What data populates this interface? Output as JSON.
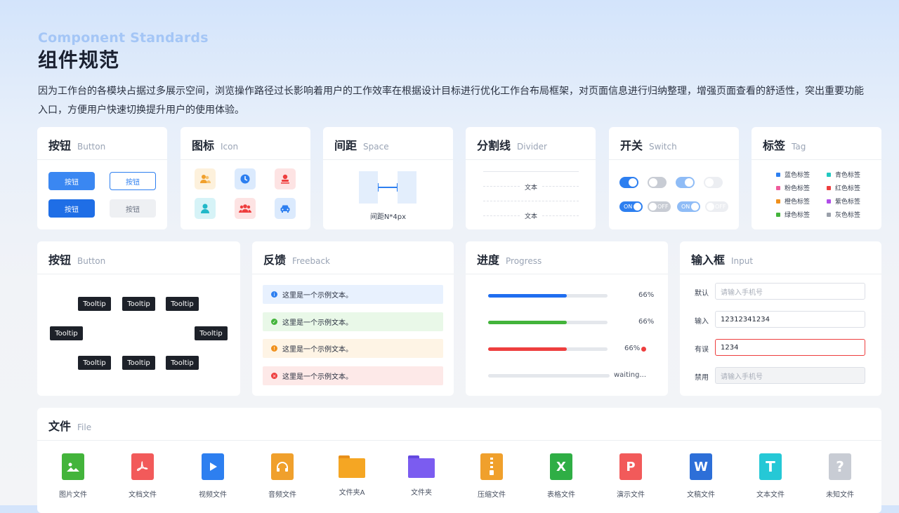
{
  "header": {
    "title_en": "Component Standards",
    "title_cn": "组件规范",
    "description": "因为工作台的各模块占据过多展示空间，浏览操作路径过长影响着用户的工作效率在根据设计目标进行优化工作台布局框架，对页面信息进行归纳整理，增强页面查看的舒适性，突出重要功能入口，方便用户快速切换提升用户的使用体验。"
  },
  "colors": {
    "primary": "#2d7ff0",
    "success": "#43b43b",
    "warning": "#f0901c",
    "error": "#ee3e3e"
  },
  "button_card": {
    "title": "按钮",
    "subtitle": "Button",
    "buttons": [
      "按钮",
      "按钮",
      "按钮",
      "按钮"
    ]
  },
  "icon_card": {
    "title": "图标",
    "subtitle": "Icon",
    "icons": [
      "users-icon",
      "clock-icon",
      "stamp-icon",
      "user-icon",
      "group-icon",
      "car-icon"
    ]
  },
  "space_card": {
    "title": "间距",
    "subtitle": "Space",
    "label": "间距N*4px"
  },
  "divider_card": {
    "title": "分割线",
    "subtitle": "Divider",
    "text1": "文本",
    "text2": "文本"
  },
  "switch_card": {
    "title": "开关",
    "subtitle": "Switch",
    "on": "ON",
    "off": "OFF"
  },
  "tag_card": {
    "title": "标签",
    "subtitle": "Tag",
    "tags": [
      {
        "label": "蓝色标签",
        "color": "#2d7ff0"
      },
      {
        "label": "青色标签",
        "color": "#21c8c0"
      },
      {
        "label": "粉色标签",
        "color": "#ef5b9c"
      },
      {
        "label": "红色标签",
        "color": "#ee3e3e"
      },
      {
        "label": "橙色标签",
        "color": "#f0901c"
      },
      {
        "label": "紫色标签",
        "color": "#b04ce8"
      },
      {
        "label": "绿色标签",
        "color": "#43b43b"
      },
      {
        "label": "灰色标签",
        "color": "#9aa0aa"
      }
    ]
  },
  "tooltip_card": {
    "title": "按钮",
    "subtitle": "Button",
    "tooltip": "Tooltip"
  },
  "feedback_card": {
    "title": "反馈",
    "subtitle": "Freeback",
    "messages": [
      "这里是一个示例文本。",
      "这里是一个示例文本。",
      "这里是一个示例文本。",
      "这里是一个示例文本。"
    ]
  },
  "progress_card": {
    "title": "进度",
    "subtitle": "Progress",
    "bars": [
      {
        "label": "66%",
        "value": 0.66,
        "color": "#1f6ef0"
      },
      {
        "label": "66%",
        "value": 0.66,
        "color": "#43b43b"
      },
      {
        "label": "66%",
        "value": 0.66,
        "color": "#ee3e3e"
      },
      {
        "label": "waiting...",
        "value": 0,
        "color": "#d9dce2"
      }
    ]
  },
  "input_card": {
    "title": "输入框",
    "subtitle": "Input",
    "rows": [
      {
        "label": "默认",
        "value": "",
        "placeholder": "请输入手机号"
      },
      {
        "label": "输入",
        "value": "12312341234",
        "placeholder": ""
      },
      {
        "label": "有误",
        "value": "1234",
        "placeholder": ""
      },
      {
        "label": "禁用",
        "value": "",
        "placeholder": "请输入手机号"
      }
    ]
  },
  "file_card": {
    "title": "文件",
    "subtitle": "File",
    "files": [
      {
        "label": "图片文件",
        "color": "#43b43b",
        "icon": "image-file-icon"
      },
      {
        "label": "文档文件",
        "color": "#f25a5a",
        "icon": "pdf-file-icon"
      },
      {
        "label": "视频文件",
        "color": "#2d7ff0",
        "icon": "video-file-icon"
      },
      {
        "label": "音频文件",
        "color": "#f0a02c",
        "icon": "audio-file-icon"
      },
      {
        "label": "文件夹A",
        "color": "#f5a623",
        "icon": "folder-icon"
      },
      {
        "label": "文件夹",
        "color": "#7b5cf0",
        "icon": "folder-icon"
      },
      {
        "label": "压缩文件",
        "color": "#f0a02c",
        "icon": "zip-file-icon"
      },
      {
        "label": "表格文件",
        "color": "#2fae45",
        "icon": "excel-file-icon"
      },
      {
        "label": "演示文件",
        "color": "#f25a5a",
        "icon": "ppt-file-icon"
      },
      {
        "label": "文稿文件",
        "color": "#2d6fd8",
        "icon": "word-file-icon"
      },
      {
        "label": "文本文件",
        "color": "#25c8d6",
        "icon": "text-file-icon"
      },
      {
        "label": "未知文件",
        "color": "#c8ccd4",
        "icon": "unknown-file-icon"
      }
    ],
    "glyphs": [
      "",
      "",
      "",
      "",
      "",
      "",
      "",
      "X",
      "P",
      "W",
      "T",
      "?"
    ]
  }
}
